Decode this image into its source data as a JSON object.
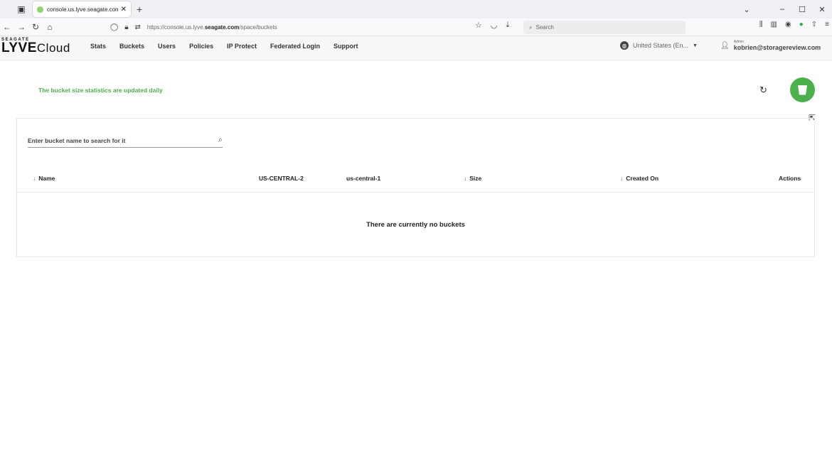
{
  "browser": {
    "tab_title": "console.us.lyve.seagate.com/sp",
    "url_prefix": "https://console.us.lyve.",
    "url_domain": "seagate.com",
    "url_path": "/space/buckets",
    "search_placeholder": "Search"
  },
  "app": {
    "brand_top": "SEAGATE",
    "brand_main": "LYVE",
    "brand_sub": "Cloud",
    "nav": [
      "Stats",
      "Buckets",
      "Users",
      "Policies",
      "IP Protect",
      "Federated Login",
      "Support"
    ],
    "language": "United States (En...",
    "user_role": "Admin",
    "user_email": "kobrien@storagereview.com"
  },
  "main": {
    "notice": "The bucket size statistics are updated daily",
    "search_placeholder": "Enter bucket name to search for it",
    "columns": {
      "name": "Name",
      "region1": "US-CENTRAL-2",
      "region2": "us-central-1",
      "size": "Size",
      "created": "Created On",
      "actions": "Actions"
    },
    "empty_message": "There are currently no buckets"
  }
}
